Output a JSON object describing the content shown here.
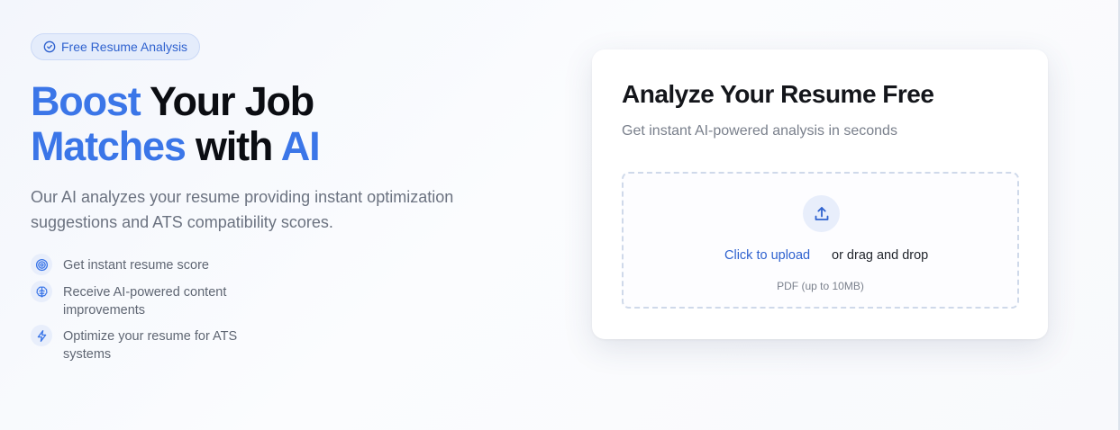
{
  "badge": {
    "label": "Free Resume Analysis",
    "icon": "check-circle-icon"
  },
  "headline": {
    "line1_blue": "Boost",
    "line1_dark": " Your Job",
    "line2_blue": "Matches",
    "line2_dark": " with ",
    "line2_blue2": "AI"
  },
  "subtext": {
    "line1": "Our AI analyzes your resume providing instant optimization",
    "line2": "suggestions and ATS compatibility scores."
  },
  "features": [
    {
      "icon": "target-icon",
      "line1": "Get instant resume score",
      "line2": ""
    },
    {
      "icon": "brain-icon",
      "line1": "Receive AI-powered content",
      "line2": "improvements"
    },
    {
      "icon": "lightning-icon",
      "line1": "Optimize your resume for ATS",
      "line2": "systems"
    }
  ],
  "card": {
    "title": "Analyze Your Resume Free",
    "subtitle": "Get instant AI-powered analysis in seconds",
    "upload": {
      "icon": "upload-icon",
      "link_label": "Click to upload",
      "drag_text": "or drag and drop",
      "hint": "PDF (up to 10MB)"
    }
  },
  "colors": {
    "accent": "#3b76e8",
    "link": "#2f62cf",
    "text_dark": "#0b0d12",
    "text_muted": "#6b7280"
  }
}
